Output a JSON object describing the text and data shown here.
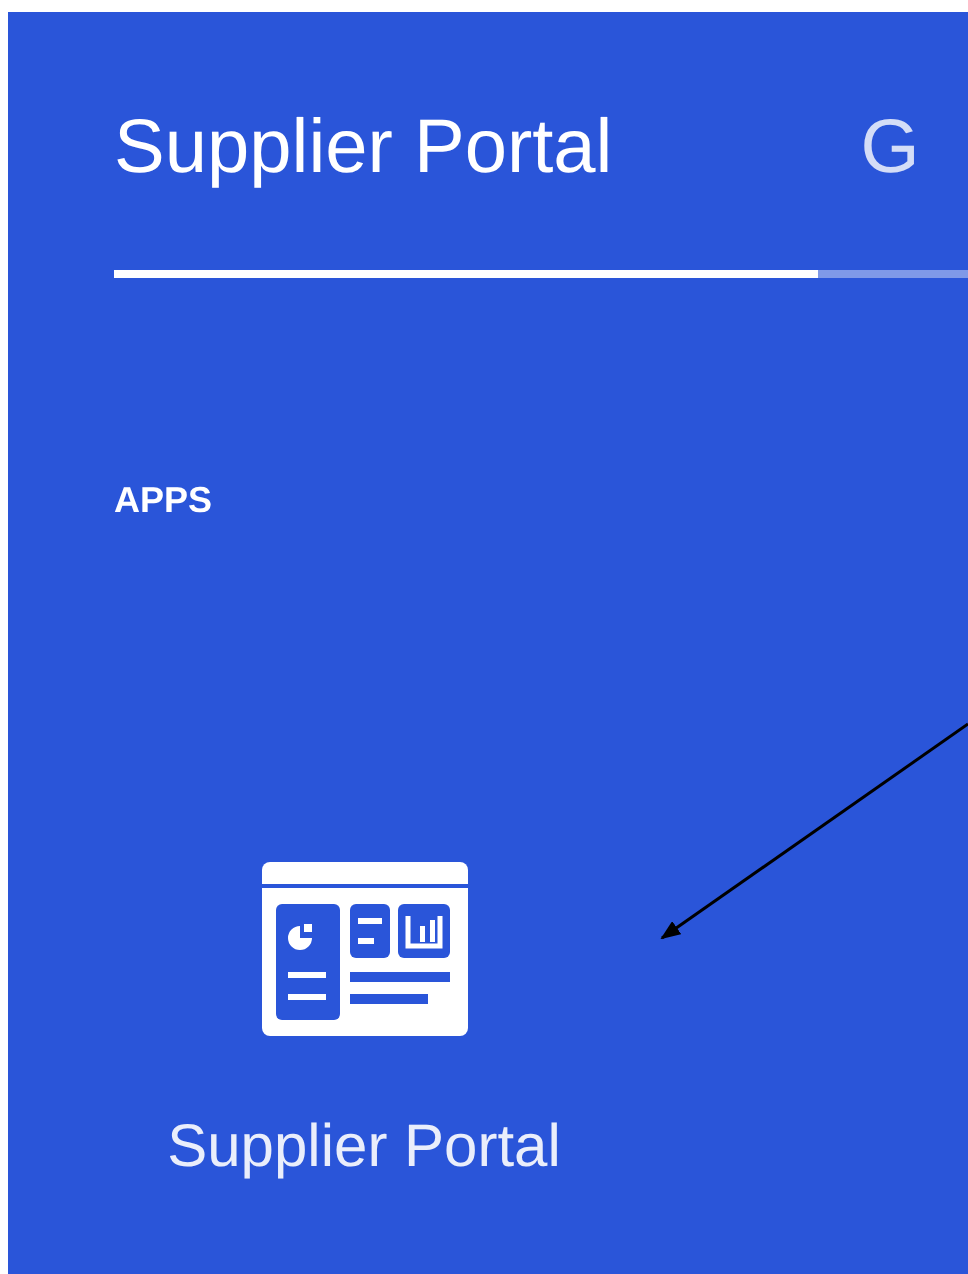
{
  "tabs": [
    {
      "label": "Supplier Portal",
      "selected": true
    },
    {
      "label": "G",
      "selected": false
    }
  ],
  "section": {
    "title": "APPS"
  },
  "apps": [
    {
      "label": "Supplier Portal"
    }
  ]
}
